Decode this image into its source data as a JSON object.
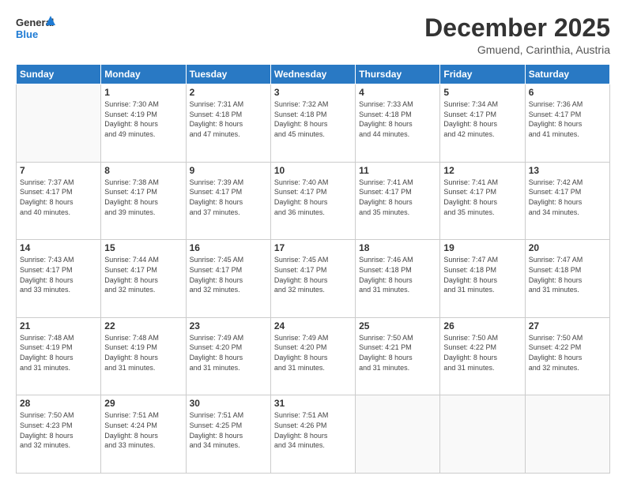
{
  "logo": {
    "line1": "General",
    "line2": "Blue"
  },
  "header": {
    "month": "December 2025",
    "location": "Gmuend, Carinthia, Austria"
  },
  "weekdays": [
    "Sunday",
    "Monday",
    "Tuesday",
    "Wednesday",
    "Thursday",
    "Friday",
    "Saturday"
  ],
  "weeks": [
    [
      {
        "day": null
      },
      {
        "day": 1,
        "sunrise": "7:30 AM",
        "sunset": "4:19 PM",
        "daylight": "8 hours and 49 minutes."
      },
      {
        "day": 2,
        "sunrise": "7:31 AM",
        "sunset": "4:18 PM",
        "daylight": "8 hours and 47 minutes."
      },
      {
        "day": 3,
        "sunrise": "7:32 AM",
        "sunset": "4:18 PM",
        "daylight": "8 hours and 45 minutes."
      },
      {
        "day": 4,
        "sunrise": "7:33 AM",
        "sunset": "4:18 PM",
        "daylight": "8 hours and 44 minutes."
      },
      {
        "day": 5,
        "sunrise": "7:34 AM",
        "sunset": "4:17 PM",
        "daylight": "8 hours and 42 minutes."
      },
      {
        "day": 6,
        "sunrise": "7:36 AM",
        "sunset": "4:17 PM",
        "daylight": "8 hours and 41 minutes."
      }
    ],
    [
      {
        "day": 7,
        "sunrise": "7:37 AM",
        "sunset": "4:17 PM",
        "daylight": "8 hours and 40 minutes."
      },
      {
        "day": 8,
        "sunrise": "7:38 AM",
        "sunset": "4:17 PM",
        "daylight": "8 hours and 39 minutes."
      },
      {
        "day": 9,
        "sunrise": "7:39 AM",
        "sunset": "4:17 PM",
        "daylight": "8 hours and 37 minutes."
      },
      {
        "day": 10,
        "sunrise": "7:40 AM",
        "sunset": "4:17 PM",
        "daylight": "8 hours and 36 minutes."
      },
      {
        "day": 11,
        "sunrise": "7:41 AM",
        "sunset": "4:17 PM",
        "daylight": "8 hours and 35 minutes."
      },
      {
        "day": 12,
        "sunrise": "7:41 AM",
        "sunset": "4:17 PM",
        "daylight": "8 hours and 35 minutes."
      },
      {
        "day": 13,
        "sunrise": "7:42 AM",
        "sunset": "4:17 PM",
        "daylight": "8 hours and 34 minutes."
      }
    ],
    [
      {
        "day": 14,
        "sunrise": "7:43 AM",
        "sunset": "4:17 PM",
        "daylight": "8 hours and 33 minutes."
      },
      {
        "day": 15,
        "sunrise": "7:44 AM",
        "sunset": "4:17 PM",
        "daylight": "8 hours and 32 minutes."
      },
      {
        "day": 16,
        "sunrise": "7:45 AM",
        "sunset": "4:17 PM",
        "daylight": "8 hours and 32 minutes."
      },
      {
        "day": 17,
        "sunrise": "7:45 AM",
        "sunset": "4:17 PM",
        "daylight": "8 hours and 32 minutes."
      },
      {
        "day": 18,
        "sunrise": "7:46 AM",
        "sunset": "4:18 PM",
        "daylight": "8 hours and 31 minutes."
      },
      {
        "day": 19,
        "sunrise": "7:47 AM",
        "sunset": "4:18 PM",
        "daylight": "8 hours and 31 minutes."
      },
      {
        "day": 20,
        "sunrise": "7:47 AM",
        "sunset": "4:18 PM",
        "daylight": "8 hours and 31 minutes."
      }
    ],
    [
      {
        "day": 21,
        "sunrise": "7:48 AM",
        "sunset": "4:19 PM",
        "daylight": "8 hours and 31 minutes."
      },
      {
        "day": 22,
        "sunrise": "7:48 AM",
        "sunset": "4:19 PM",
        "daylight": "8 hours and 31 minutes."
      },
      {
        "day": 23,
        "sunrise": "7:49 AM",
        "sunset": "4:20 PM",
        "daylight": "8 hours and 31 minutes."
      },
      {
        "day": 24,
        "sunrise": "7:49 AM",
        "sunset": "4:20 PM",
        "daylight": "8 hours and 31 minutes."
      },
      {
        "day": 25,
        "sunrise": "7:50 AM",
        "sunset": "4:21 PM",
        "daylight": "8 hours and 31 minutes."
      },
      {
        "day": 26,
        "sunrise": "7:50 AM",
        "sunset": "4:22 PM",
        "daylight": "8 hours and 31 minutes."
      },
      {
        "day": 27,
        "sunrise": "7:50 AM",
        "sunset": "4:22 PM",
        "daylight": "8 hours and 32 minutes."
      }
    ],
    [
      {
        "day": 28,
        "sunrise": "7:50 AM",
        "sunset": "4:23 PM",
        "daylight": "8 hours and 32 minutes."
      },
      {
        "day": 29,
        "sunrise": "7:51 AM",
        "sunset": "4:24 PM",
        "daylight": "8 hours and 33 minutes."
      },
      {
        "day": 30,
        "sunrise": "7:51 AM",
        "sunset": "4:25 PM",
        "daylight": "8 hours and 34 minutes."
      },
      {
        "day": 31,
        "sunrise": "7:51 AM",
        "sunset": "4:26 PM",
        "daylight": "8 hours and 34 minutes."
      },
      {
        "day": null
      },
      {
        "day": null
      },
      {
        "day": null
      }
    ]
  ]
}
